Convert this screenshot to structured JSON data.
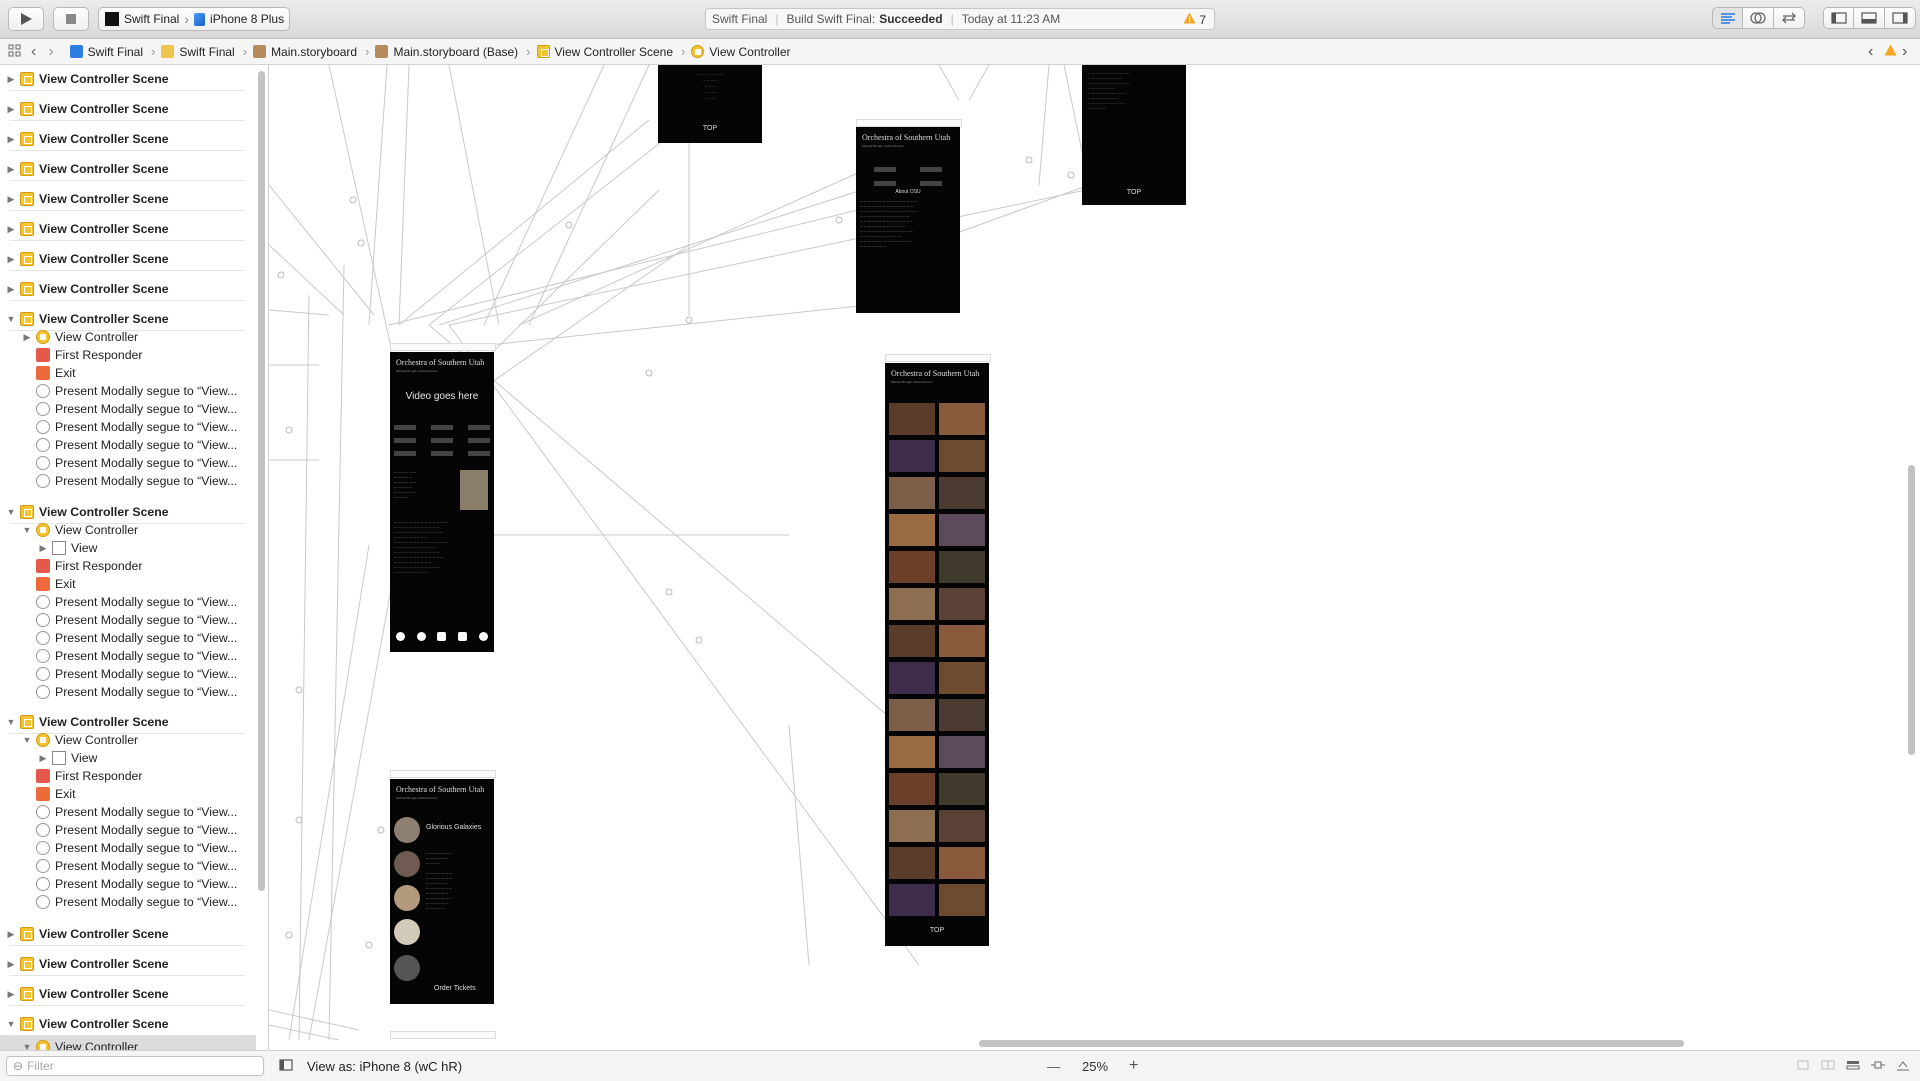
{
  "toolbar": {
    "scheme_target": "Swift Final",
    "scheme_device": "iPhone 8 Plus",
    "activity_project": "Swift Final",
    "activity_status_prefix": "Build Swift Final:",
    "activity_status_result": "Succeeded",
    "activity_time": "Today at 11:23 AM",
    "warning_count": "7"
  },
  "jumpbar": {
    "items": [
      "Swift Final",
      "Swift Final",
      "Main.storyboard",
      "Main.storyboard (Base)",
      "View Controller Scene",
      "View Controller"
    ]
  },
  "navigator": {
    "scene_label": "View Controller Scene",
    "vc_label": "View Controller",
    "first_responder_label": "First Responder",
    "exit_label": "Exit",
    "view_label": "View",
    "segue_label": "Present Modally segue to “View...",
    "filter_placeholder": "Filter"
  },
  "canvas": {
    "screen_title": "Orchestra of Southern Utah",
    "screen_subtitle": "Michael Brough, Music Director",
    "video_label": "Video goes here",
    "top_label": "TOP",
    "about_label": "About OSU",
    "event_title": "Glorious Galaxies",
    "order_label": "Order Tickets"
  },
  "bottombar": {
    "view_as": "View as: iPhone 8 (wC hR)",
    "zoom": "25%",
    "zoom_out": "—",
    "zoom_in": "+"
  },
  "colors": {
    "accent": "#1a73e8",
    "scene_icon": "#f4c430",
    "responder_icon": "#e5594a",
    "warning": "#f5a623"
  }
}
